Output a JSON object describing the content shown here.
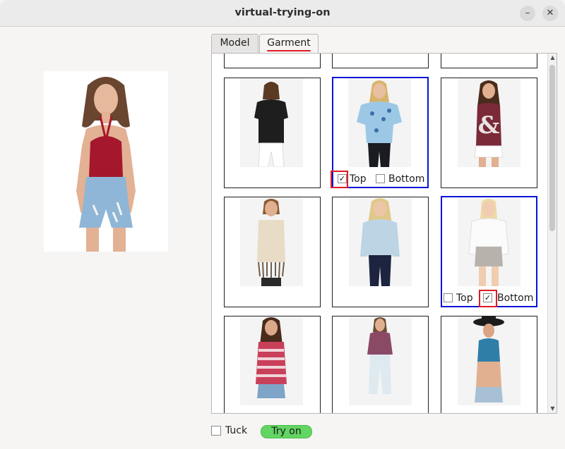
{
  "window": {
    "title": "virtual-trying-on",
    "minimize_glyph": "–",
    "close_glyph": "✕"
  },
  "tabs": [
    {
      "label": "Model",
      "active": false
    },
    {
      "label": "Garment",
      "active": true
    }
  ],
  "options": {
    "top_label": "Top",
    "bottom_label": "Bottom",
    "check_glyph": "✓"
  },
  "garments": [
    {
      "item": "black lace top",
      "selected": false,
      "top_checked": false,
      "bottom_checked": false
    },
    {
      "item": "blue floral top",
      "selected": true,
      "top_checked": true,
      "bottom_checked": false
    },
    {
      "item": "maroon ampersand tank",
      "selected": false,
      "top_checked": false,
      "bottom_checked": false
    },
    {
      "item": "crochet fringe top",
      "selected": false,
      "top_checked": false,
      "bottom_checked": false
    },
    {
      "item": "light blue sweater",
      "selected": false,
      "top_checked": false,
      "bottom_checked": false
    },
    {
      "item": "white top with grey shorts",
      "selected": true,
      "top_checked": false,
      "bottom_checked": true
    },
    {
      "item": "red striped tank",
      "selected": false,
      "top_checked": false,
      "bottom_checked": false
    },
    {
      "item": "purple crop top",
      "selected": false,
      "top_checked": false,
      "bottom_checked": false
    },
    {
      "item": "teal crop top with hat",
      "selected": false,
      "top_checked": false,
      "bottom_checked": false
    }
  ],
  "footer": {
    "tuck_label": "Tuck",
    "tuck_checked": false,
    "try_on_label": "Try on"
  },
  "colors": {
    "selection_border": "#0a14d8",
    "highlight": "#e01b24",
    "try_on_button": "#62d562"
  }
}
